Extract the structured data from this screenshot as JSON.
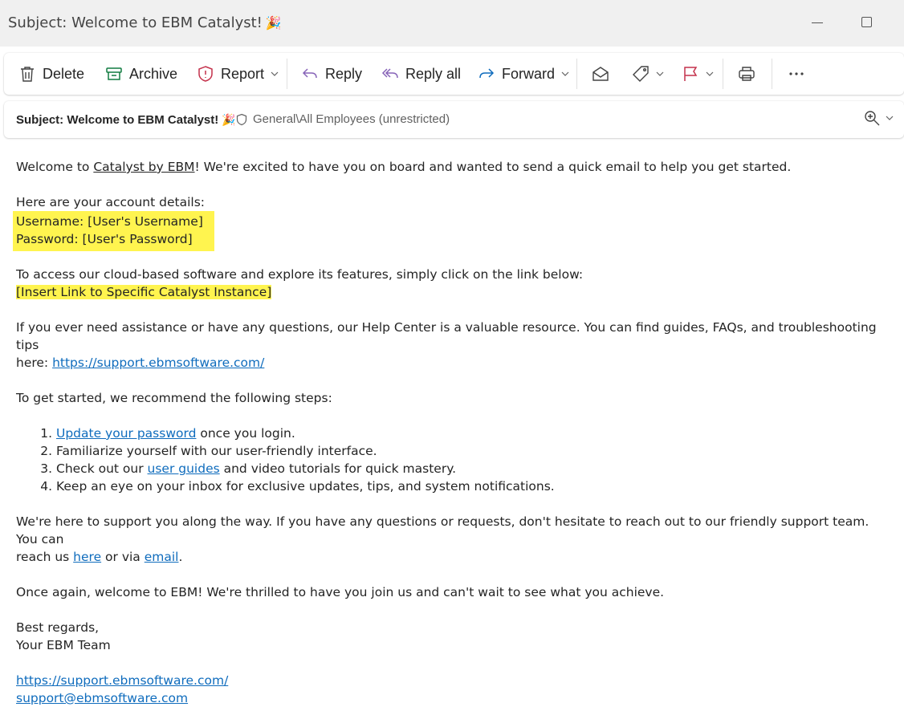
{
  "window": {
    "title": "Subject: Welcome to EBM Catalyst!",
    "title_emoji": "🎉"
  },
  "toolbar": {
    "delete": "Delete",
    "archive": "Archive",
    "report": "Report",
    "reply": "Reply",
    "reply_all": "Reply all",
    "forward": "Forward"
  },
  "subject_bar": {
    "subject": "Subject: Welcome to EBM Catalyst!",
    "emoji": "🎉",
    "sensitivity": "General\\All Employees (unrestricted)"
  },
  "body": {
    "intro_pre": "Welcome to ",
    "intro_link": "Catalyst by EBM",
    "intro_post": "! We're excited to have you on board and wanted to send a quick email to help you get started.",
    "account_heading": "Here are your account details:",
    "username_line": "Username: [User's Username]",
    "password_line": "Password: [User's Password]",
    "access_line": "To access our cloud-based software and explore its features, simply click on the link below:",
    "instance_link": "[Insert Link to Specific Catalyst Instance]",
    "help_line_1": "If you ever need assistance or have any questions, our Help Center is a valuable resource. You can find guides, FAQs, and troubleshooting tips",
    "help_line_2_pre": "here: ",
    "help_link": "https://support.ebmsoftware.com/",
    "steps_intro": "To get started, we recommend the following steps:",
    "steps": {
      "s1_link": "Update your password",
      "s1_post": " once you login.",
      "s2": "Familiarize yourself with our user-friendly interface.",
      "s3_pre": "Check out our ",
      "s3_link": "user guides",
      "s3_post": " and video tutorials for quick mastery.",
      "s4": "Keep an eye on your inbox for exclusive updates, tips, and system notifications."
    },
    "support_line_1": "We're here to support you along the way. If you have any questions or requests, don't hesitate to reach out to our friendly support team. You can",
    "support_line_2_pre": "reach us ",
    "support_here": "here",
    "support_mid": " or via ",
    "support_email": "email",
    "support_end": ".",
    "closing": "Once again, welcome to EBM! We're thrilled to have you join us and can't wait to see what you achieve.",
    "regards": "Best regards,",
    "team": "Your EBM Team",
    "footer_link": "https://support.ebmsoftware.com/",
    "footer_email": "support@ebmsoftware.com"
  },
  "colors": {
    "link": "#0f6cbd",
    "highlight": "#fff44f",
    "archive_icon": "#107c41",
    "report_icon": "#c4314b",
    "reply_icon": "#8764b8",
    "forward_icon": "#0f6cbd",
    "flag_icon": "#c4314b"
  },
  "icons": [
    "trash-icon",
    "archive-icon",
    "shield-report-icon",
    "reply-icon",
    "reply-all-icon",
    "forward-icon",
    "envelope-open-icon",
    "tag-icon",
    "flag-icon",
    "printer-icon",
    "more-icon",
    "shield-icon",
    "zoom-icon",
    "chevron-down-icon"
  ]
}
